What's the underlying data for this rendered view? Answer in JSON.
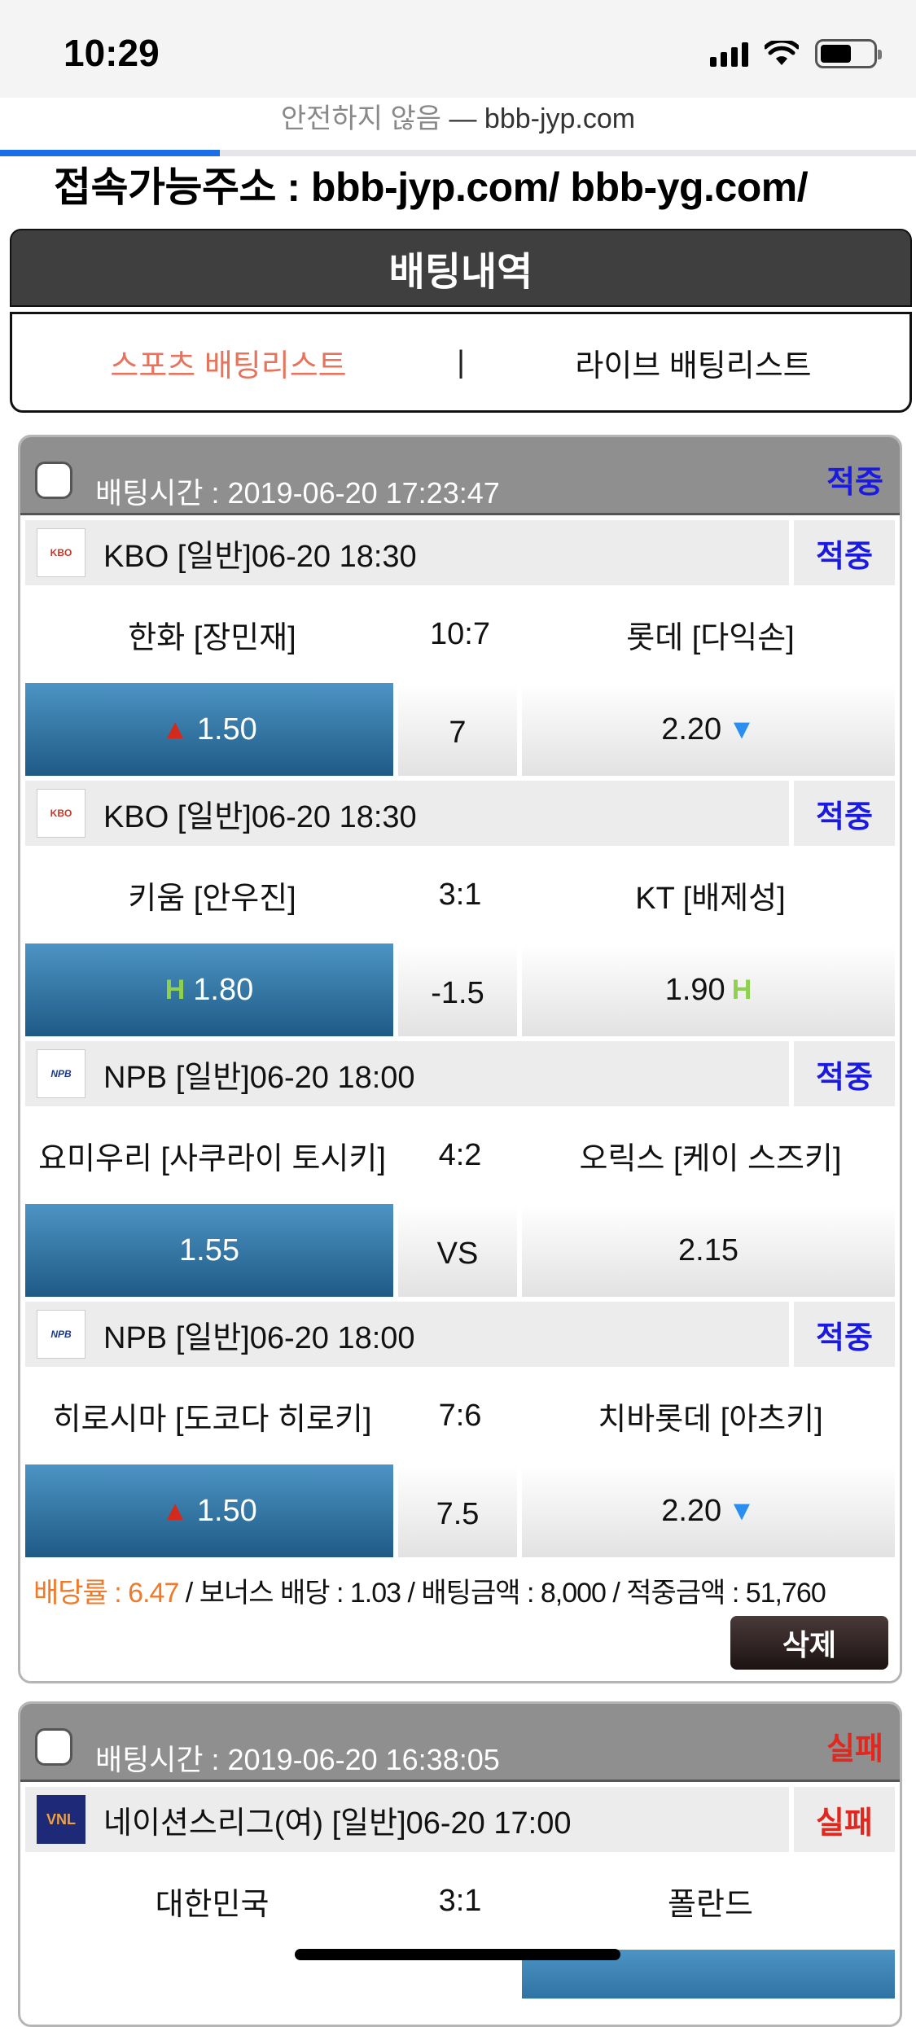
{
  "status": {
    "time": "10:29"
  },
  "browser": {
    "insecure_label": "안전하지 않음",
    "separator": "—",
    "domain": "bbb-jyp.com",
    "load_progress": 0.24
  },
  "notice": "접속가능주소 : bbb-jyp.com/ bbb-yg.com/",
  "page_title": "배팅내역",
  "tabs": {
    "sports": "스포츠 배팅리스트",
    "separator": "|",
    "live": "라이브 배팅리스트"
  },
  "bets": [
    {
      "time_label": "배팅시간 : 2019-06-20 17:23:47",
      "result": "적중",
      "games": [
        {
          "logo": "KBO",
          "league": "KBO [일반]06-20 18:30",
          "result": "적중",
          "home": "한화 [장민재]",
          "score": "10:7",
          "away": "롯데 [다익손]",
          "home_odds": "1.50",
          "mid": "7",
          "away_odds": "2.20"
        },
        {
          "logo": "KBO",
          "league": "KBO [일반]06-20 18:30",
          "result": "적중",
          "home": "키움 [안우진]",
          "score": "3:1",
          "away": "KT [배제성]",
          "home_odds": "1.80",
          "mid": "-1.5",
          "away_odds": "1.90"
        },
        {
          "logo": "NPB",
          "league": "NPB [일반]06-20 18:00",
          "result": "적중",
          "home": "요미우리 [사쿠라이 토시키]",
          "score": "4:2",
          "away": "오릭스 [케이 스즈키]",
          "home_odds": "1.55",
          "mid": "VS",
          "away_odds": "2.15"
        },
        {
          "logo": "NPB",
          "league": "NPB [일반]06-20 18:00",
          "result": "적중",
          "home": "히로시마 [도코다 히로키]",
          "score": "7:6",
          "away": "치바롯데 [아츠키]",
          "home_odds": "1.50",
          "mid": "7.5",
          "away_odds": "2.20"
        }
      ],
      "summary": {
        "rate": "배당률 : 6.47",
        "rest": " / 보너스 배당 : 1.03 / 배팅금액 : 8,000 / 적중금액 : 51,760"
      },
      "delete_label": "삭제"
    },
    {
      "time_label": "배팅시간 : 2019-06-20 16:38:05",
      "result": "실패",
      "games": [
        {
          "logo": "VNL",
          "league": "네이션스리그(여) [일반]06-20 17:00",
          "result": "실패",
          "home": "대한민국",
          "score": "3:1",
          "away": "폴란드"
        }
      ]
    }
  ],
  "colors": {
    "hit": "#1a1ae0",
    "fail": "#e0281f",
    "active_tab": "#e8735c",
    "rate": "#ef7a2a",
    "odds_selected": "#2f73a4"
  },
  "icons": [
    "signal-icon",
    "wifi-icon",
    "battery-icon",
    "arrow-up-icon",
    "arrow-down-icon",
    "handicap-icon",
    "checkbox-icon"
  ]
}
